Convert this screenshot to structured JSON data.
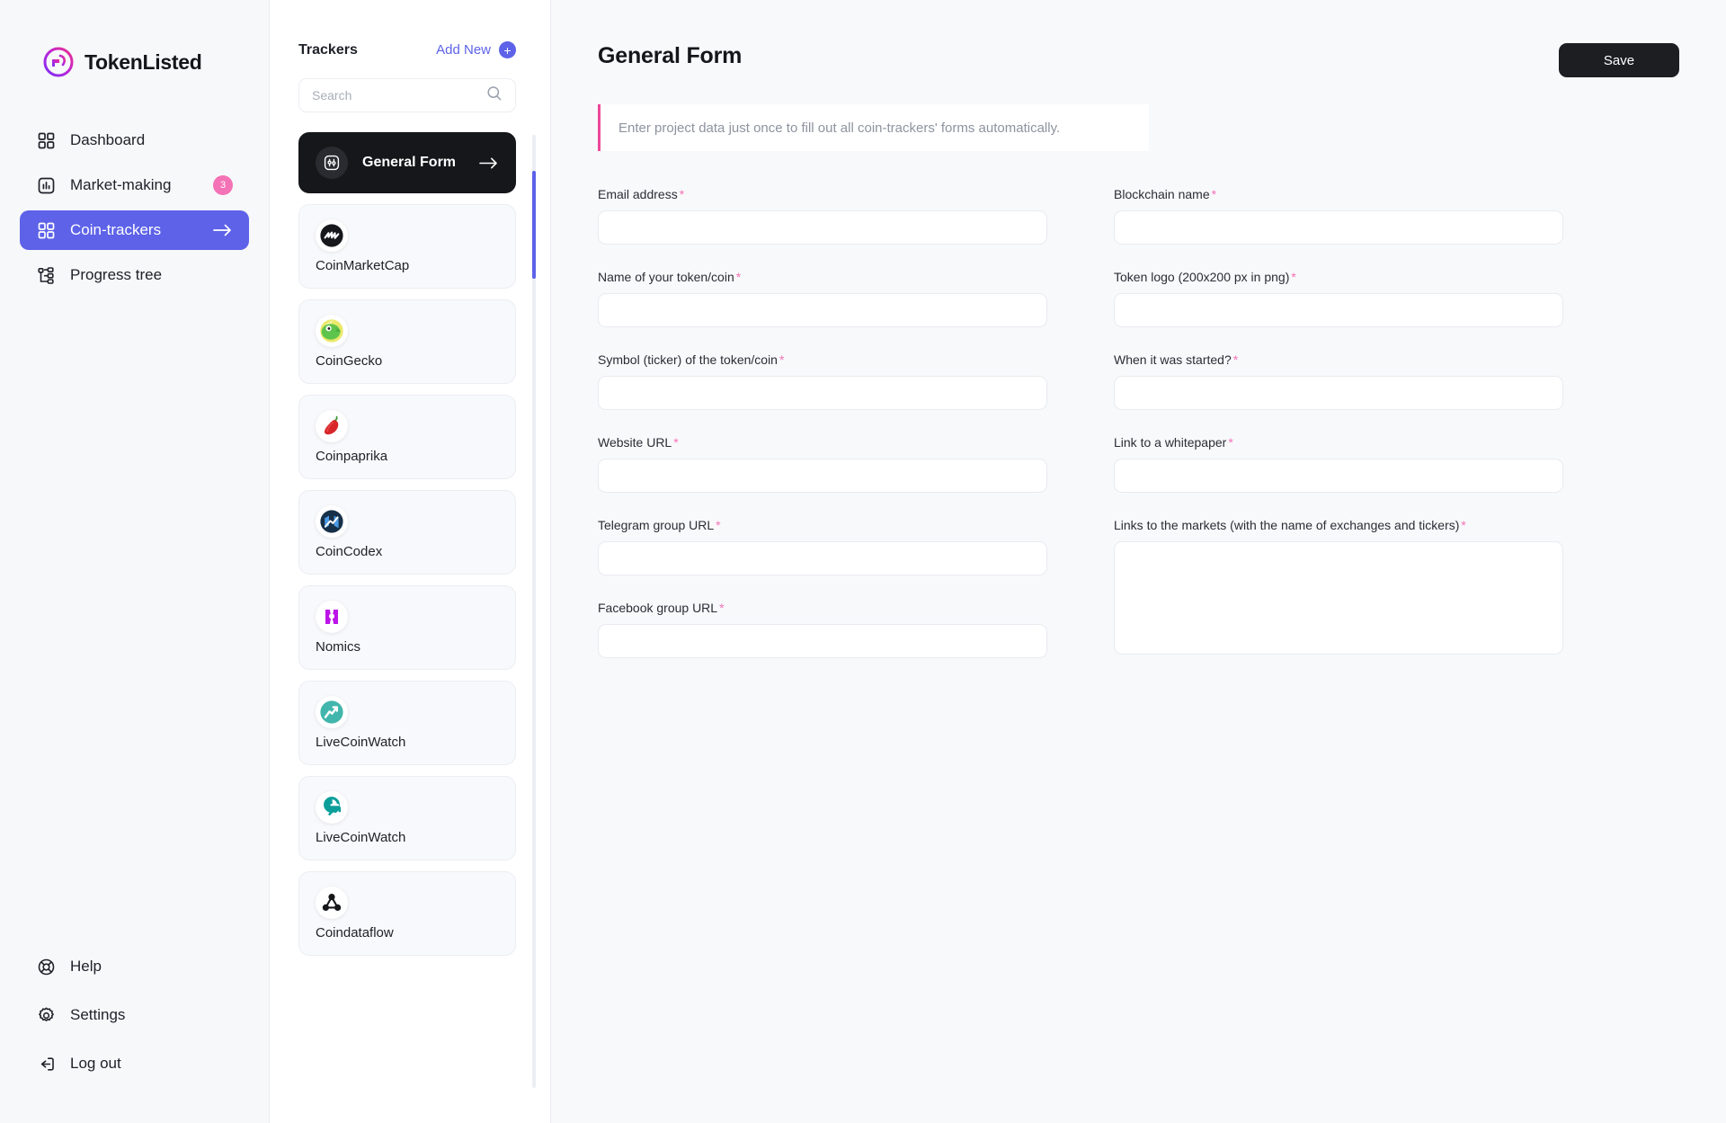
{
  "brand": {
    "name": "TokenListed",
    "logo_icon": "tokenlisted-logo-icon"
  },
  "sidebar": {
    "items": [
      {
        "label": "Dashboard",
        "icon": "grid-icon",
        "active": false
      },
      {
        "label": "Market-making",
        "icon": "chart-box-icon",
        "active": false,
        "badge": "3"
      },
      {
        "label": "Coin-trackers",
        "icon": "grid-icon",
        "active": true,
        "arrow": "arrow-right-icon"
      },
      {
        "label": "Progress tree",
        "icon": "tree-icon",
        "active": false
      }
    ],
    "bottom_items": [
      {
        "label": "Help",
        "icon": "lifebuoy-icon"
      },
      {
        "label": "Settings",
        "icon": "gear-icon"
      },
      {
        "label": "Log out",
        "icon": "logout-icon"
      }
    ]
  },
  "trackers_panel": {
    "title": "Trackers",
    "add_new_label": "Add New",
    "add_new_icon": "plus-circle-icon",
    "search": {
      "value": "",
      "placeholder": "Search",
      "icon": "search-icon"
    },
    "general_form": {
      "label": "General Form",
      "icon": "sliders-icon",
      "arrow_icon": "arrow-right-icon",
      "selected": true
    },
    "cards": [
      {
        "name": "CoinMarketCap",
        "icon": "coinmarketcap-icon"
      },
      {
        "name": "CoinGecko",
        "icon": "coingecko-icon"
      },
      {
        "name": "Coinpaprika",
        "icon": "coinpaprika-icon"
      },
      {
        "name": "CoinCodex",
        "icon": "coincodex-icon"
      },
      {
        "name": "Nomics",
        "icon": "nomics-icon"
      },
      {
        "name": "LiveCoinWatch",
        "icon": "livecoinwatch-icon"
      },
      {
        "name": "LiveCoinWatch",
        "icon": "livecoinwatch-alt-icon"
      },
      {
        "name": "Coindataflow",
        "icon": "coindataflow-icon"
      }
    ]
  },
  "main": {
    "page_title": "General Form",
    "save_label": "Save",
    "info_text": "Enter project data just once to fill out all coin-trackers' forms automatically.",
    "required_marker": "*",
    "left_fields": [
      {
        "label": "Email address",
        "value": "",
        "placeholder": "",
        "required": true
      },
      {
        "label": "Name of your token/coin",
        "value": "",
        "placeholder": "",
        "required": true
      },
      {
        "label": "Symbol (ticker) of the token/coin",
        "value": "",
        "placeholder": "",
        "required": true
      },
      {
        "label": "Website URL",
        "value": "",
        "placeholder": "",
        "required": true
      },
      {
        "label": "Telegram group URL",
        "value": "",
        "placeholder": "",
        "required": true
      },
      {
        "label": "Facebook group URL",
        "value": "",
        "placeholder": "",
        "required": true
      }
    ],
    "right_fields": [
      {
        "label": "Blockchain name",
        "value": "",
        "placeholder": "",
        "required": true
      },
      {
        "label": "Token logo (200x200 px in png)",
        "value": "",
        "placeholder": "",
        "required": true
      },
      {
        "label": "When it was started?",
        "value": "",
        "placeholder": "",
        "required": true
      },
      {
        "label": "Link to a whitepaper",
        "value": "",
        "placeholder": "",
        "required": true
      },
      {
        "label": "Links to the markets (with the name of exchanges and tickers)",
        "value": "",
        "placeholder": "",
        "required": true,
        "multiline": true
      }
    ]
  },
  "colors": {
    "accent_indigo": "#5d62e8",
    "badge_pink": "#f472b6",
    "banner_pink": "#ec4899",
    "dark": "#16171a",
    "page_bg": "#f8f9fb"
  }
}
